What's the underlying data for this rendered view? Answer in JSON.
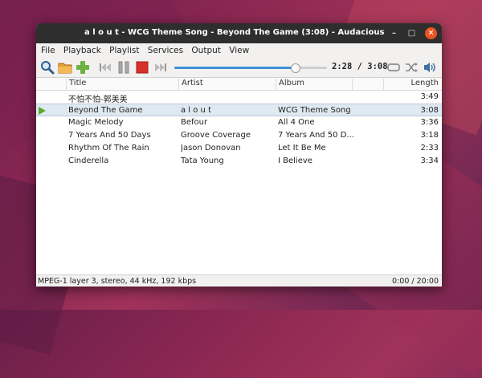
{
  "window": {
    "title": "a l o u t - WCG Theme Song - Beyond The Game (3:08) - Audacious",
    "controls": {
      "minimize": "–",
      "maximize": "□",
      "close": "✕"
    }
  },
  "menu": [
    {
      "label": "File"
    },
    {
      "label": "Playback"
    },
    {
      "label": "Playlist"
    },
    {
      "label": "Services"
    },
    {
      "label": "Output"
    },
    {
      "label": "View"
    }
  ],
  "toolbar": {
    "icons": [
      "search-icon",
      "open-folder-icon",
      "add-icon",
      "previous-icon",
      "pause-icon",
      "stop-icon",
      "next-icon",
      "repeat-icon",
      "shuffle-icon",
      "volume-icon"
    ],
    "time": "2:28 / 3:08",
    "progress_fraction": 0.787
  },
  "playlist": {
    "columns": {
      "title": "Title",
      "artist": "Artist",
      "album": "Album",
      "length": "Length"
    },
    "rows": [
      {
        "title": "不怕不怕-郭美美",
        "artist": "",
        "album": "",
        "length": "3:49",
        "playing": false
      },
      {
        "title": "Beyond The Game",
        "artist": "a l o u t",
        "album": "WCG Theme Song",
        "length": "3:08",
        "playing": true
      },
      {
        "title": "Magic  Melody",
        "artist": "Befour",
        "album": "All 4 One",
        "length": "3:36",
        "playing": false
      },
      {
        "title": "7 Years And 50 Days",
        "artist": "Groove Coverage",
        "album": "7 Years And 50 D...",
        "length": "3:18",
        "playing": false
      },
      {
        "title": "Rhythm Of The Rain",
        "artist": "Jason Donovan",
        "album": "Let It Be Me",
        "length": "2:33",
        "playing": false
      },
      {
        "title": "Cinderella",
        "artist": "Tata Young",
        "album": "I Believe",
        "length": "3:34",
        "playing": false
      }
    ]
  },
  "status": {
    "info": "MPEG-1 layer 3, stereo, 44 kHz, 192 kbps",
    "playlist_time": "0:00 / 20:00"
  },
  "colors": {
    "accent": "#3d8fd6",
    "close": "#e95420",
    "play_marker": "#5aa832",
    "stop": "#d9302c"
  }
}
